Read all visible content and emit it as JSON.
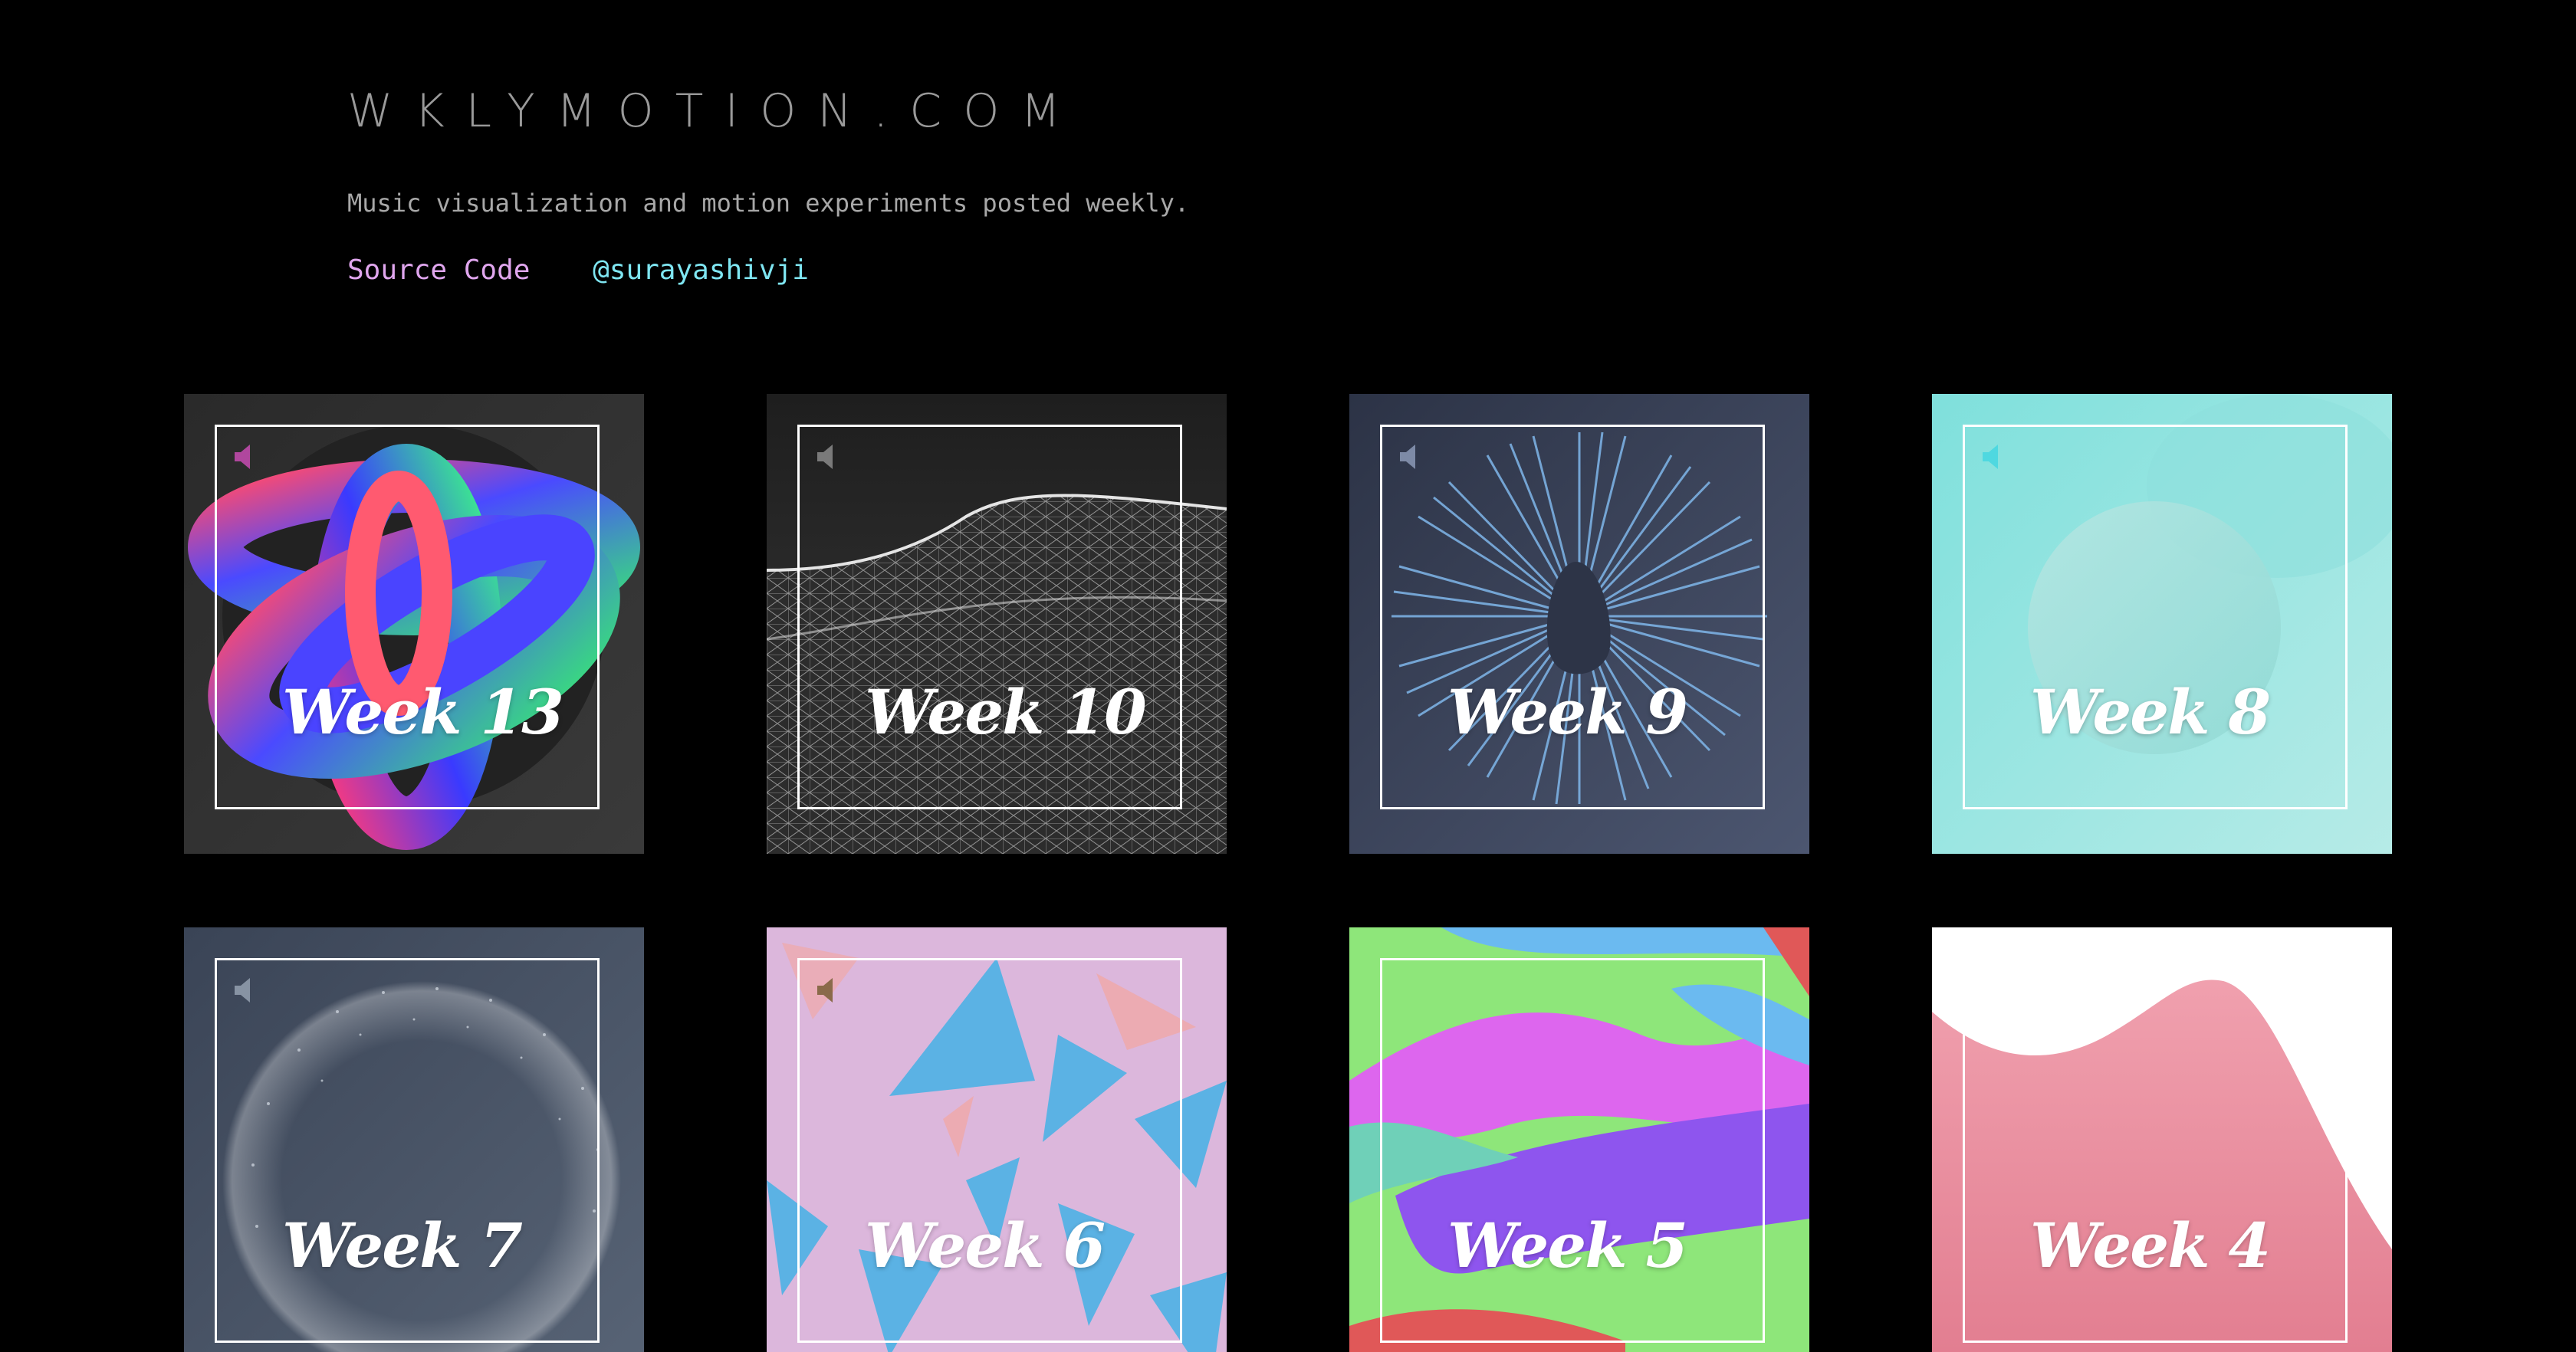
{
  "site": {
    "title": "WKLYMOTION.COM",
    "tagline": "Music visualization and motion experiments posted weekly.",
    "links": {
      "source": "Source Code",
      "twitter": "@surayashivji"
    }
  },
  "tiles": [
    {
      "label": "Week 13",
      "speaker_color": "#b0479e"
    },
    {
      "label": "Week 10",
      "speaker_color": "#7a7a7a"
    },
    {
      "label": "Week 9",
      "speaker_color": "#7d8aa6"
    },
    {
      "label": "Week 8",
      "speaker_color": "#4fd8e0"
    },
    {
      "label": "Week 7",
      "speaker_color": "#8793a3"
    },
    {
      "label": "Week 6",
      "speaker_color": "#8a6a4a"
    },
    {
      "label": "Week 5",
      "speaker_color": "#8a6a4a"
    },
    {
      "label": "Week 4",
      "speaker_color": "#d0d0d0"
    }
  ]
}
